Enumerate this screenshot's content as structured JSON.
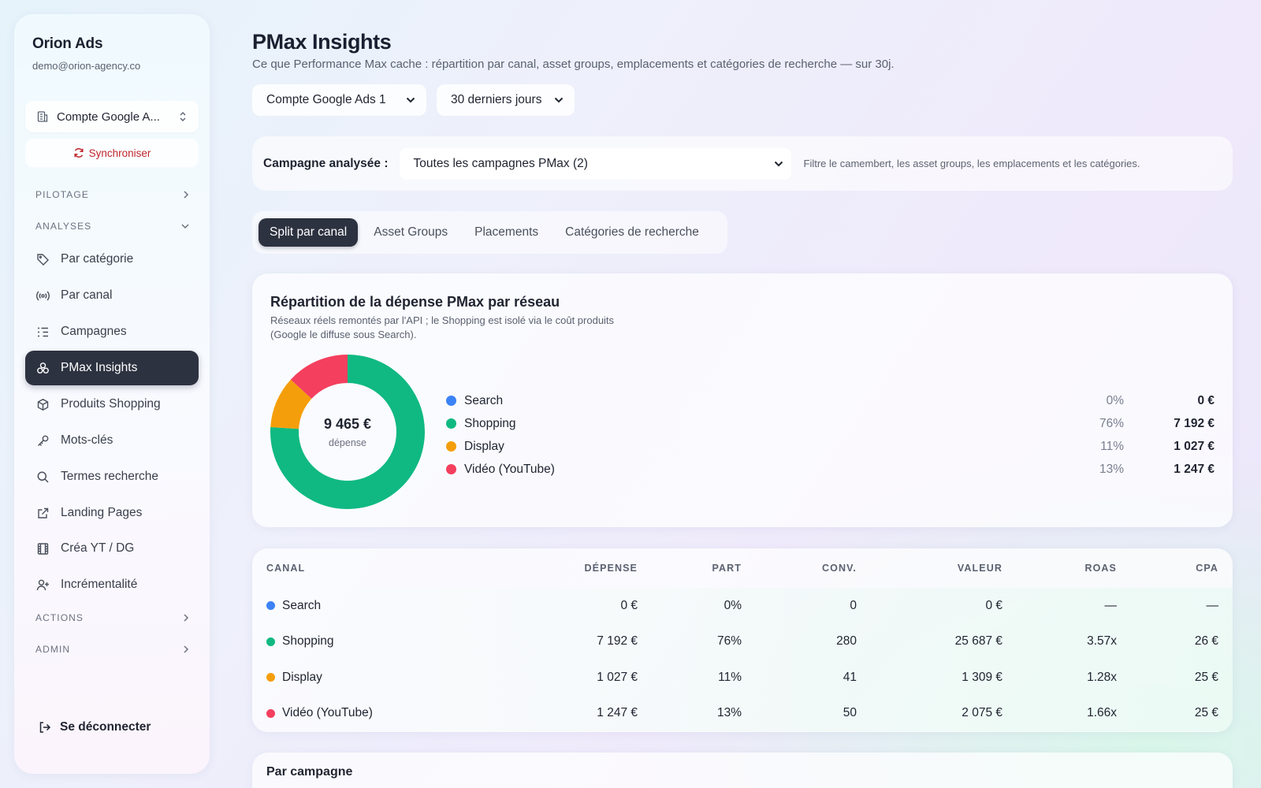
{
  "sidebar": {
    "brand": "Orion Ads",
    "email": "demo@orion-agency.co",
    "account_select": "Compte Google A...",
    "sync_label": "Synchroniser",
    "sections": {
      "pilotage": "PILOTAGE",
      "analyses": "ANALYSES",
      "actions": "ACTIONS",
      "admin": "ADMIN"
    },
    "items": [
      {
        "label": "Par catégorie",
        "icon": "tag-icon"
      },
      {
        "label": "Par canal",
        "icon": "broadcast-icon"
      },
      {
        "label": "Campagnes",
        "icon": "list-icon"
      },
      {
        "label": "PMax Insights",
        "icon": "circles-icon",
        "active": true
      },
      {
        "label": "Produits Shopping",
        "icon": "box-icon"
      },
      {
        "label": "Mots-clés",
        "icon": "key-icon"
      },
      {
        "label": "Termes recherche",
        "icon": "search-icon"
      },
      {
        "label": "Landing Pages",
        "icon": "external-link-icon"
      },
      {
        "label": "Créa YT / DG",
        "icon": "film-icon"
      },
      {
        "label": "Incrémentalité",
        "icon": "user-plus-icon"
      }
    ],
    "logout": "Se déconnecter"
  },
  "header": {
    "title": "PMax Insights",
    "subtitle": "Ce que Performance Max cache : répartition par canal, asset groups, emplacements et catégories de recherche — sur 30j.",
    "account_filter": "Compte Google Ads 1",
    "period_filter": "30 derniers jours"
  },
  "campaign_bar": {
    "label": "Campagne analysée :",
    "selected": "Toutes les campagnes PMax (2)",
    "hint": "Filtre le camembert, les asset groups, les emplacements et les catégories."
  },
  "tabs": [
    "Split par canal",
    "Asset Groups",
    "Placements",
    "Catégories de recherche"
  ],
  "chart_card": {
    "title": "Répartition de la dépense PMax par réseau",
    "subtitle": "Réseaux réels remontés par l'API ; le Shopping est isolé via le coût produits (Google le diffuse sous Search).",
    "total": "9 465 €",
    "total_caption": "dépense"
  },
  "chart_data": {
    "type": "pie",
    "categories": [
      "Search",
      "Shopping",
      "Display",
      "Vidéo (YouTube)"
    ],
    "values": [
      0,
      7192,
      1027,
      1247
    ],
    "percent_labels": [
      "0%",
      "76%",
      "11%",
      "13%"
    ],
    "value_labels": [
      "0 €",
      "7 192 €",
      "1 027 €",
      "1 247 €"
    ],
    "colors": [
      "#3b82f6",
      "#10b981",
      "#f59e0b",
      "#f43f5e"
    ],
    "donut": true
  },
  "table": {
    "headers": [
      "CANAL",
      "DÉPENSE",
      "PART",
      "CONV.",
      "VALEUR",
      "ROAS",
      "CPA"
    ],
    "rows": [
      {
        "canal": "Search",
        "color": "#3b82f6",
        "depense": "0 €",
        "part": "0%",
        "conv": "0",
        "valeur": "0 €",
        "roas": "—",
        "cpa": "—"
      },
      {
        "canal": "Shopping",
        "color": "#10b981",
        "depense": "7 192 €",
        "part": "76%",
        "conv": "280",
        "valeur": "25 687 €",
        "roas": "3.57x",
        "cpa": "26 €"
      },
      {
        "canal": "Display",
        "color": "#f59e0b",
        "depense": "1 027 €",
        "part": "11%",
        "conv": "41",
        "valeur": "1 309 €",
        "roas": "1.28x",
        "cpa": "25 €"
      },
      {
        "canal": "Vidéo (YouTube)",
        "color": "#f43f5e",
        "depense": "1 247 €",
        "part": "13%",
        "conv": "50",
        "valeur": "2 075 €",
        "roas": "1.66x",
        "cpa": "25 €"
      }
    ]
  },
  "bottom_card": {
    "title": "Par campagne"
  }
}
